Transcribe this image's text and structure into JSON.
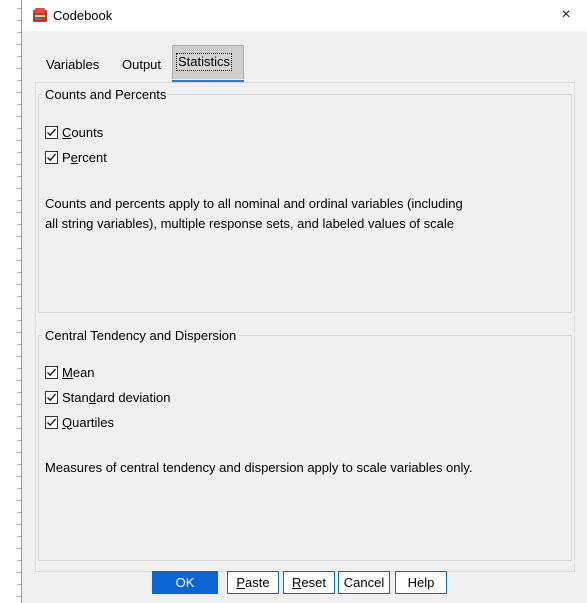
{
  "window": {
    "title": "Codebook",
    "close_glyph": "×"
  },
  "tabs": [
    {
      "label": "Variables",
      "active": false
    },
    {
      "label": "Output",
      "active": false
    },
    {
      "label": "Statistics",
      "active": true
    }
  ],
  "counts_group": {
    "legend": "Counts and Percents",
    "items": [
      {
        "pre": "",
        "mnemonic": "C",
        "post": "ounts",
        "checked": true
      },
      {
        "pre": "P",
        "mnemonic": "e",
        "post": "rcent",
        "checked": true
      }
    ],
    "note_line1": "Counts and percents apply to all nominal and ordinal variables (including",
    "note_line2": "all string variables), multiple response sets, and labeled values of scale"
  },
  "central_group": {
    "legend": "Central Tendency and Dispersion",
    "items": [
      {
        "pre": "",
        "mnemonic": "M",
        "post": "ean",
        "checked": true
      },
      {
        "pre": "Stan",
        "mnemonic": "d",
        "post": "ard deviation",
        "checked": true
      },
      {
        "pre": "",
        "mnemonic": "Q",
        "post": "uartiles",
        "checked": true
      }
    ],
    "note": "Measures of central tendency and dispersion apply to scale variables only."
  },
  "buttons": {
    "ok": {
      "label": "OK"
    },
    "paste": {
      "pre": "",
      "mnemonic": "P",
      "post": "aste"
    },
    "reset": {
      "pre": "",
      "mnemonic": "R",
      "post": "eset"
    },
    "cancel": {
      "label": "Cancel"
    },
    "help": {
      "label": "Help"
    }
  },
  "colors": {
    "accent": "#0a64d2",
    "tab_underline": "#2a78d6",
    "dialog_bg": "#f0f0f0"
  },
  "icons": {
    "app": "codebook-app-icon",
    "close": "close-icon",
    "check": "checkmark-icon"
  }
}
